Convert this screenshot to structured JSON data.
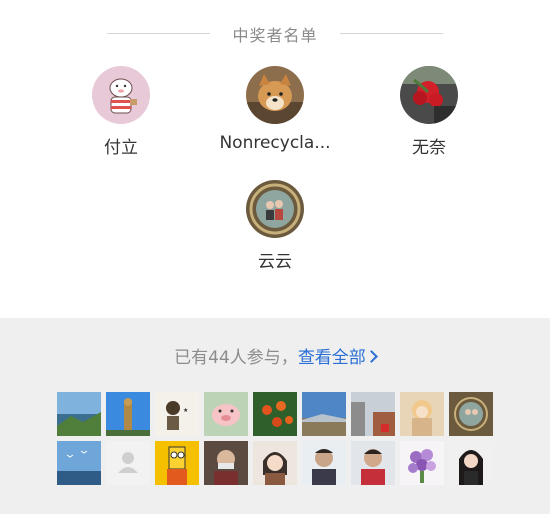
{
  "winners_section": {
    "title": "中奖者名单",
    "winners": [
      {
        "name": "付立",
        "avatar": "cartoon-sheep-avatar"
      },
      {
        "name": "Nonrecycla...",
        "avatar": "shiba-dog-avatar"
      },
      {
        "name": "无奈",
        "avatar": "red-flower-avatar"
      },
      {
        "name": "云云",
        "avatar": "couple-photo-avatar"
      }
    ]
  },
  "participants": {
    "count_text": "已有44人参与，",
    "view_all_label": "查看全部",
    "avatars_row1": [
      "mountain-coast",
      "buddha-statue",
      "cartoon-boy",
      "pig-face",
      "persimmon-tree",
      "blue-sky-field",
      "street-scene",
      "anime-girl",
      "couple-frame"
    ],
    "avatars_row2": [
      "sea-birds",
      "default-user",
      "bart-simpson",
      "woman-mask",
      "illustrated-girl",
      "woman-portrait",
      "woman-red-shirt",
      "flower-bouquet",
      "dark-hair-girl"
    ]
  }
}
